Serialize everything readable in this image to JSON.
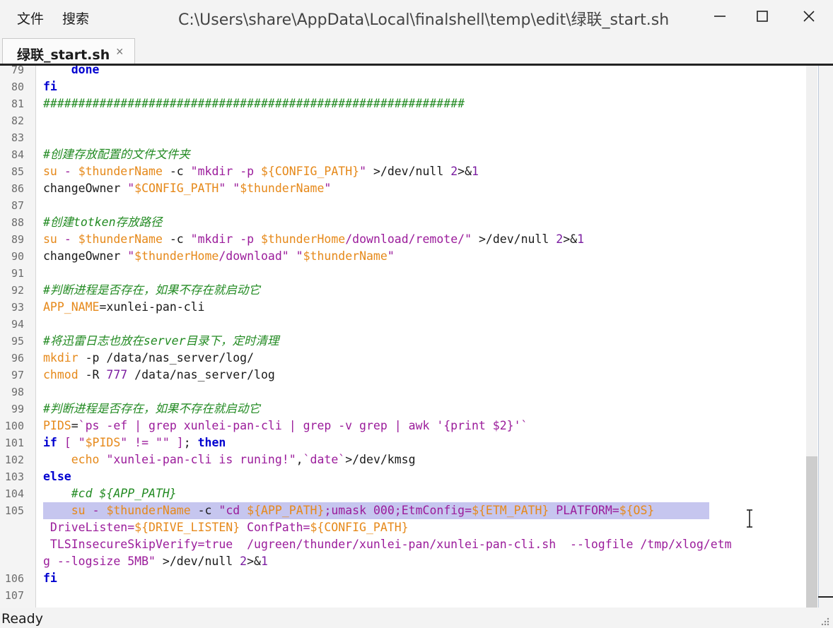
{
  "menu": {
    "file": "文件",
    "search": "搜索"
  },
  "window": {
    "title": "C:\\Users\\share\\AppData\\Local\\finalshell\\temp\\edit\\绿联_start.sh"
  },
  "tab": {
    "label": "绿联_start.sh",
    "close": "×"
  },
  "status": {
    "text": "Ready"
  },
  "lines": {
    "l79": {
      "num": "79"
    },
    "l80": {
      "num": "80"
    },
    "l81": {
      "num": "81",
      "c1": "############################################################"
    },
    "l82": {
      "num": "82"
    },
    "l83": {
      "num": "83"
    },
    "l84": {
      "num": "84",
      "c1": "#创建存放配置的文件文件夹"
    },
    "l85": {
      "num": "85"
    },
    "l86": {
      "num": "86"
    },
    "l87": {
      "num": "87"
    },
    "l88": {
      "num": "88",
      "c1": "#创建totken存放路径"
    },
    "l89": {
      "num": "89"
    },
    "l90": {
      "num": "90"
    },
    "l91": {
      "num": "91"
    },
    "l92": {
      "num": "92",
      "c1": "#判断进程是否存在，如果不存在就启动它"
    },
    "l93": {
      "num": "93"
    },
    "l94": {
      "num": "94"
    },
    "l95": {
      "num": "95",
      "c1": "#将迅雷日志也放在server目录下，定时清理"
    },
    "l96": {
      "num": "96"
    },
    "l97": {
      "num": "97"
    },
    "l98": {
      "num": "98"
    },
    "l99": {
      "num": "99",
      "c1": "#判断进程是否存在，如果不存在就启动它"
    },
    "l100": {
      "num": "100"
    },
    "l101": {
      "num": "101"
    },
    "l102": {
      "num": "102"
    },
    "l103": {
      "num": "103"
    },
    "l104": {
      "num": "104"
    },
    "l105": {
      "num": "105"
    },
    "l106": {
      "num": "106"
    },
    "l107": {
      "num": "107"
    }
  }
}
